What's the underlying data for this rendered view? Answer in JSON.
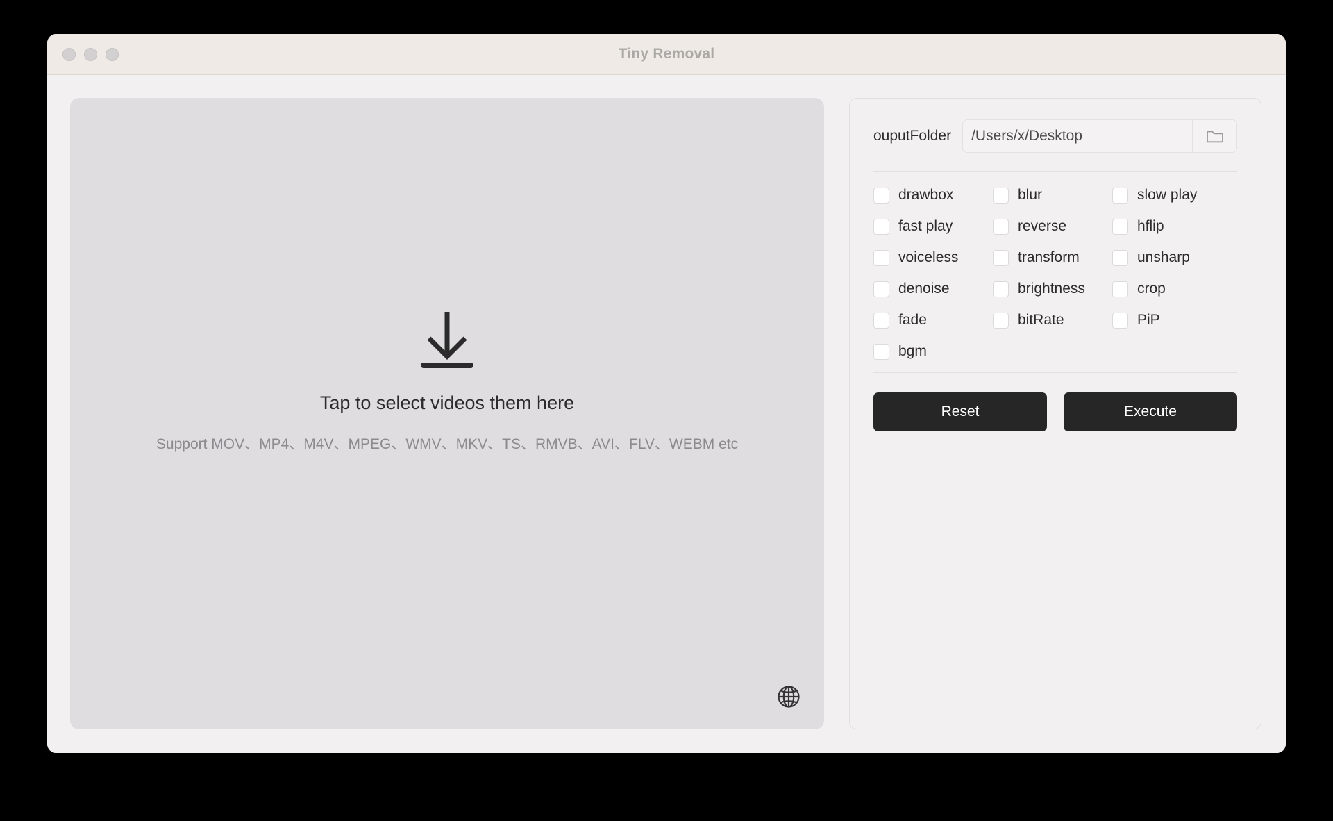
{
  "window": {
    "title": "Tiny Removal",
    "traffic_lights": [
      "close",
      "minimize",
      "maximize"
    ]
  },
  "dropzone": {
    "icon": "download-arrow-icon",
    "title": "Tap to select videos them here",
    "supported_formats_text": "Support MOV、MP4、M4V、MPEG、WMV、MKV、TS、RMVB、AVI、FLV、WEBM etc",
    "globe_icon": "globe-icon"
  },
  "panel": {
    "output_folder": {
      "label": "ouputFolder",
      "value": "/Users/x/Desktop",
      "placeholder": "/Users/x/Desktop",
      "browse_icon": "folder-icon"
    },
    "options": [
      {
        "label": "drawbox",
        "checked": false
      },
      {
        "label": "blur",
        "checked": false
      },
      {
        "label": "slow play",
        "checked": false
      },
      {
        "label": "fast play",
        "checked": false
      },
      {
        "label": "reverse",
        "checked": false
      },
      {
        "label": "hflip",
        "checked": false
      },
      {
        "label": "voiceless",
        "checked": false
      },
      {
        "label": "transform",
        "checked": false
      },
      {
        "label": "unsharp",
        "checked": false
      },
      {
        "label": "denoise",
        "checked": false
      },
      {
        "label": "brightness",
        "checked": false
      },
      {
        "label": "crop",
        "checked": false
      },
      {
        "label": "fade",
        "checked": false
      },
      {
        "label": "bitRate",
        "checked": false
      },
      {
        "label": "PiP",
        "checked": false
      },
      {
        "label": "bgm",
        "checked": false
      }
    ],
    "buttons": {
      "reset": "Reset",
      "execute": "Execute"
    }
  },
  "colors": {
    "desktop_background": "#000000",
    "titlebar": "#EFEAE5",
    "window_body": "#F2F0F0",
    "dropzone": "#DFDDE0",
    "button_dark": "#262626",
    "title_text": "#ABA8A6",
    "muted_text": "#8B8A8C"
  }
}
